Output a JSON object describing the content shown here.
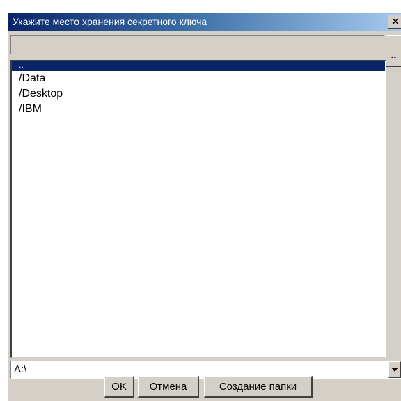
{
  "window": {
    "title": "Укажите место хранения секретного ключа",
    "close_label": "✕"
  },
  "path_field": {
    "value": ""
  },
  "up_button": {
    "label": ".."
  },
  "file_list": {
    "items": [
      {
        "label": "..",
        "selected": true
      },
      {
        "label": "/Data",
        "selected": false
      },
      {
        "label": "/Desktop",
        "selected": false
      },
      {
        "label": "/IBM",
        "selected": false
      }
    ]
  },
  "drive_combo": {
    "value": "A:\\"
  },
  "buttons": {
    "ok": "OK",
    "cancel": "Отмена",
    "new_folder": "Создание папки"
  },
  "colors": {
    "titlebar_start": "#0a246a",
    "titlebar_end": "#a6caf0",
    "selection": "#0a246a",
    "face": "#d4d0c8"
  }
}
